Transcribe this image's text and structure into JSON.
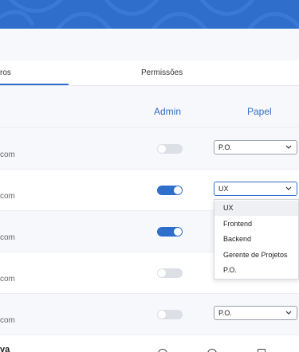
{
  "tabs": [
    {
      "label": "ros",
      "active": true
    },
    {
      "label": "Permissões",
      "active": false
    }
  ],
  "columns": {
    "admin": "Admin",
    "papel": "Papel"
  },
  "rows": [
    {
      "email": "com",
      "admin": false,
      "papel": "P.O.",
      "show_select": true
    },
    {
      "email": "com",
      "admin": true,
      "papel": "UX",
      "show_select": true
    },
    {
      "email": "com",
      "admin": true,
      "papel": "",
      "show_select": false
    },
    {
      "email": "com",
      "admin": false,
      "papel": "",
      "show_select": false
    },
    {
      "email": "com",
      "admin": false,
      "papel": "P.O.",
      "show_select": true
    },
    {
      "name": "va"
    }
  ],
  "dropdown": {
    "options": [
      "UX",
      "Frontend",
      "Backend",
      "Gerente de Projetos",
      "P.O."
    ],
    "hovered": "UX"
  },
  "colors": {
    "accent": "#2f6fcb",
    "banner": "#2f6fcb"
  }
}
